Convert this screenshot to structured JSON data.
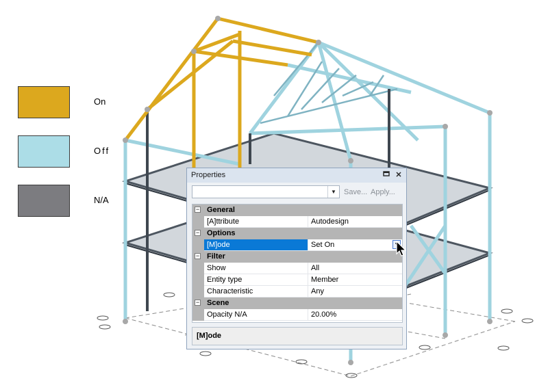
{
  "legend": [
    {
      "label": "On",
      "color": "#dca81e"
    },
    {
      "label": "Off",
      "color": "#acdde7"
    },
    {
      "label": "N/A",
      "color": "#7c7c80"
    }
  ],
  "properties_window": {
    "title": "Properties",
    "pin_icon": "pin-icon",
    "close_icon": "close-icon",
    "toolbar": {
      "combo_value": "",
      "save_label": "Save...",
      "apply_label": "Apply..."
    },
    "categories": [
      {
        "name": "General",
        "rows": [
          {
            "name": "[A]ttribute",
            "value": "Autodesign"
          }
        ]
      },
      {
        "name": "Options",
        "rows": [
          {
            "name": "[M]ode",
            "value": "Set On",
            "selected": true
          }
        ]
      },
      {
        "name": "Filter",
        "rows": [
          {
            "name": "Show",
            "value": "All"
          },
          {
            "name": "Entity type",
            "value": "Member"
          },
          {
            "name": "Characteristic",
            "value": "Any"
          }
        ]
      },
      {
        "name": "Scene",
        "rows": [
          {
            "name": "Opacity N/A",
            "value": "20.00%"
          }
        ]
      }
    ],
    "description": "[M]ode"
  }
}
